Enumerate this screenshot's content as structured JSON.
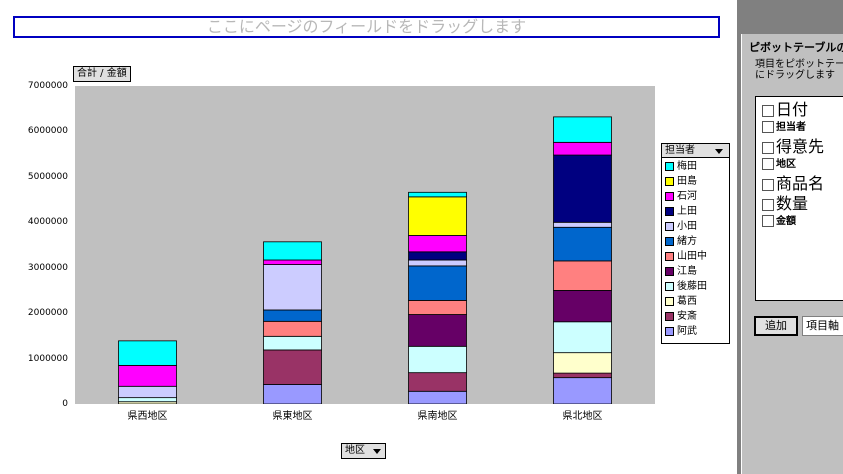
{
  "page_field_drop": "ここにページのフィールドをドラッグします",
  "data_field_button": "合計 / 金額",
  "series_field_button": "担当者",
  "category_field_button": "地区",
  "pivot_panel": {
    "title": "ピボットテーブルの",
    "description": "項目をピボットテー\nにドラッグします",
    "fields": [
      {
        "label": "日付",
        "size": "large",
        "bold": false
      },
      {
        "label": "担当者",
        "size": "small",
        "bold": true
      },
      {
        "label": "得意先",
        "size": "large",
        "bold": false
      },
      {
        "label": "地区",
        "size": "small",
        "bold": true
      },
      {
        "label": "商品名",
        "size": "large",
        "bold": false
      },
      {
        "label": "数量",
        "size": "large",
        "bold": false
      },
      {
        "label": "金額",
        "size": "small",
        "bold": true
      }
    ],
    "add_button": "追加",
    "area_select": "項目軸"
  },
  "chart_data": {
    "type": "bar",
    "stacked": true,
    "categories": [
      "県西地区",
      "県東地区",
      "県南地区",
      "県北地区"
    ],
    "ylim": [
      0,
      7000000
    ],
    "yticks": [
      "0",
      "1000000",
      "2000000",
      "3000000",
      "4000000",
      "5000000",
      "6000000",
      "7000000"
    ],
    "grid": false,
    "legend": "right",
    "series": [
      {
        "name": "阿武",
        "color": "#9999ff",
        "values": [
          0,
          430000,
          280000,
          580000
        ]
      },
      {
        "name": "安斎",
        "color": "#993366",
        "values": [
          0,
          760000,
          410000,
          100000
        ]
      },
      {
        "name": "葛西",
        "color": "#ffffcc",
        "values": [
          50000,
          0,
          0,
          450000
        ]
      },
      {
        "name": "後藤田",
        "color": "#ccffff",
        "values": [
          90000,
          300000,
          580000,
          680000
        ]
      },
      {
        "name": "江島",
        "color": "#660066",
        "values": [
          0,
          0,
          700000,
          690000
        ]
      },
      {
        "name": "山田中",
        "color": "#ff8080",
        "values": [
          0,
          330000,
          310000,
          650000
        ]
      },
      {
        "name": "緒方",
        "color": "#0066cc",
        "values": [
          0,
          250000,
          760000,
          740000
        ]
      },
      {
        "name": "小田",
        "color": "#ccccff",
        "values": [
          250000,
          1000000,
          130000,
          110000
        ]
      },
      {
        "name": "上田",
        "color": "#000080",
        "values": [
          0,
          0,
          180000,
          1480000
        ]
      },
      {
        "name": "石河",
        "color": "#ff00ff",
        "values": [
          460000,
          100000,
          360000,
          280000
        ]
      },
      {
        "name": "田島",
        "color": "#ffff00",
        "values": [
          0,
          0,
          850000,
          0
        ]
      },
      {
        "name": "梅田",
        "color": "#00ffff",
        "values": [
          540000,
          400000,
          100000,
          560000
        ]
      }
    ]
  }
}
